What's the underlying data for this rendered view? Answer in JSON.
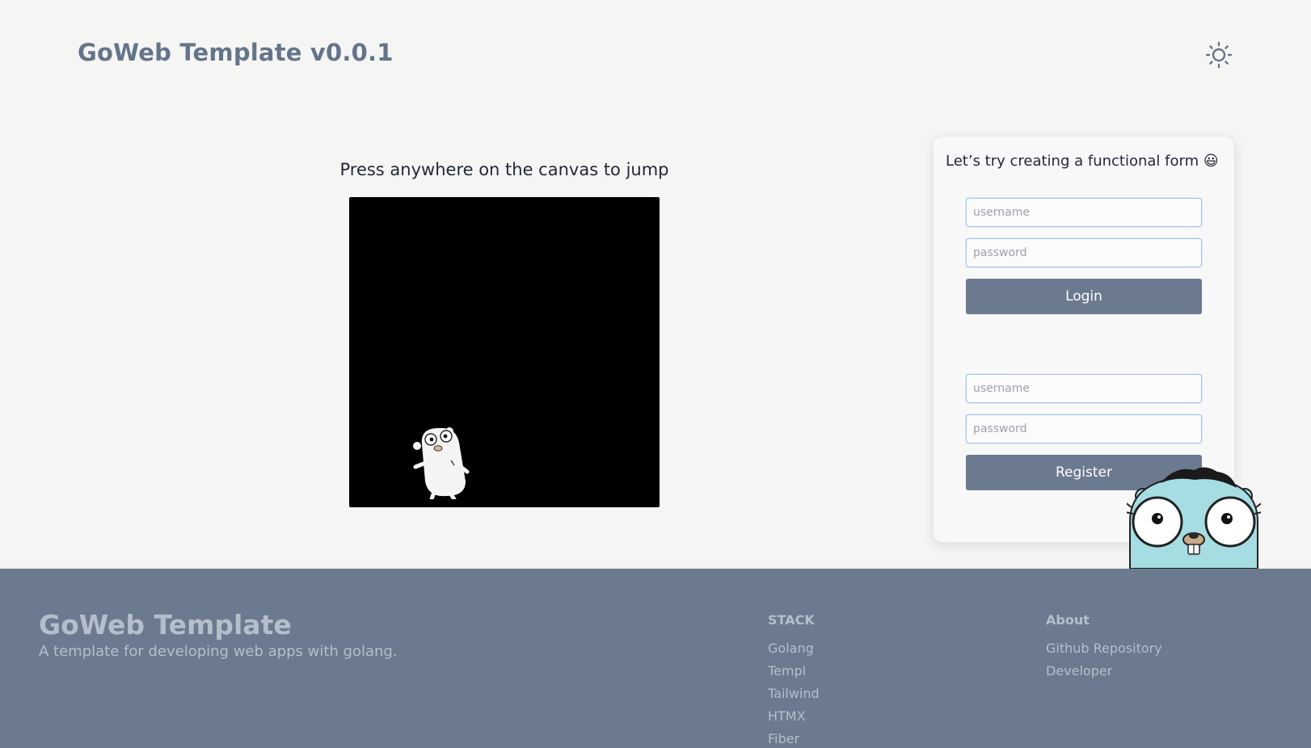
{
  "header": {
    "title": "GoWeb Template v0.0.1",
    "theme_icon": "sun-icon"
  },
  "canvas": {
    "caption": "Press anywhere on the canvas to jump",
    "background": "#000000",
    "sprite": "gopher"
  },
  "form_card": {
    "heading": "Let’s try creating a functional form 😃",
    "login": {
      "username_placeholder": "username",
      "password_placeholder": "password",
      "button_label": "Login"
    },
    "register": {
      "username_placeholder": "username",
      "password_placeholder": "password",
      "button_label": "Register"
    }
  },
  "footer": {
    "brand": "GoWeb Template",
    "tagline": "A template for developing web apps with golang.",
    "stack": {
      "title": "STACK",
      "links": [
        "Golang",
        "Templ",
        "Tailwind",
        "HTMX",
        "Fiber"
      ]
    },
    "about": {
      "title": "About",
      "links": [
        "Github Repository",
        "Developer"
      ]
    }
  },
  "colors": {
    "page_background": "#f5f6f4",
    "accent": "#6b7a8f",
    "footer_text": "#b4bfcc",
    "mascot": "#a5dde2"
  }
}
